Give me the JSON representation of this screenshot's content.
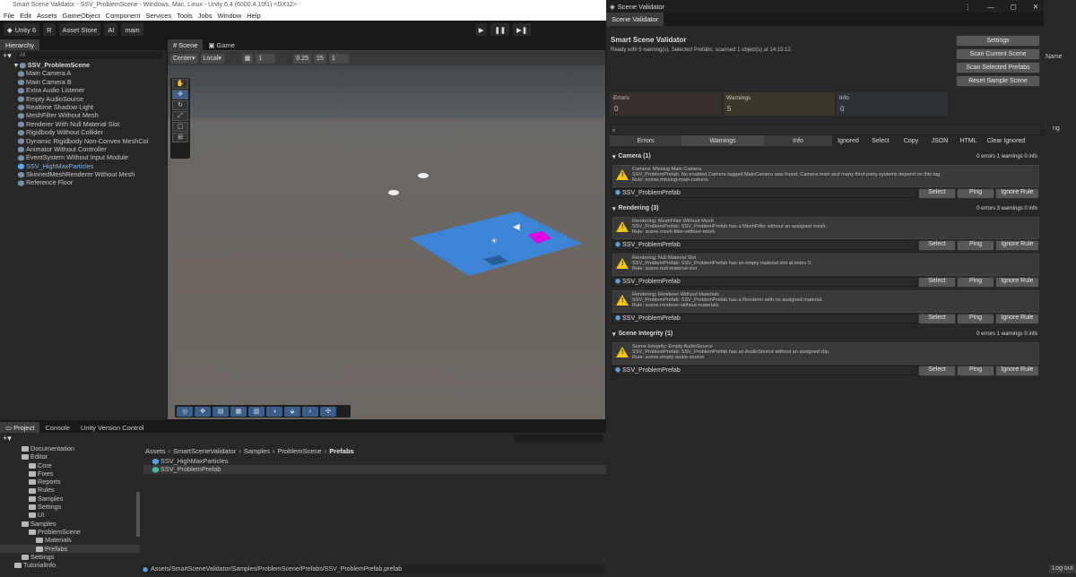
{
  "window_title": "Smart Scene Validator - SSV_ProblemScene - Windows, Mac, Linux - Unity 6.4 (6000.4.10f1) <DX12>",
  "menu": [
    "File",
    "Edit",
    "Assets",
    "GameObject",
    "Component",
    "Services",
    "Tools",
    "Jobs",
    "Window",
    "Help"
  ],
  "toolbar": {
    "account": "Unity 6",
    "user": "R",
    "asset_store": "Asset Store",
    "ai": "AI",
    "branch": "main"
  },
  "hierarchy": {
    "tab": "Hierarchy",
    "search_placeholder": "All",
    "scene": "SSV_ProblemScene",
    "items": [
      "Main Camera A",
      "Main Camera B",
      "Extra Audio Listener",
      "Empty AudioSource",
      "Realtime Shadow Light",
      "MeshFilter Without Mesh",
      "Renderer With Null Material Slot",
      "Rigidbody Without Collider",
      "Dynamic Rigidbody Non-Convex MeshCol",
      "Animator Without Controller",
      "EventSystem Without Input Module",
      "SSV_HighMaxParticles",
      "SkinnedMeshRenderer Without Mesh",
      "Reference Floor"
    ]
  },
  "scene_tabs": [
    "Scene",
    "Game"
  ],
  "scene_toolbar": {
    "pivot": "Center",
    "space": "Local",
    "grid": "1",
    "snap": "0.25",
    "angle": "15",
    "scale": "1"
  },
  "validator": {
    "window_title": "Scene Validator",
    "tab": "Scene Validator",
    "heading": "Smart Scene Validator",
    "status": "Ready with 5 warning(s). Selected Prefabs; scanned 1 object(s) at 14:15:12.",
    "buttons": [
      "Settings",
      "Scan Current Scene",
      "Scan Selected Prefabs",
      "Reset Sample Scene"
    ],
    "counters": [
      {
        "label": "Errors",
        "value": "0",
        "color": "#3a2f2f"
      },
      {
        "label": "Warnings",
        "value": "5",
        "color": "#3b3829"
      },
      {
        "label": "Info",
        "value": "0",
        "color": "#2f3338"
      }
    ],
    "filters": [
      "Errors",
      "Warnings",
      "Info",
      "Ignored",
      "Select",
      "Copy",
      "JSON",
      "HTML",
      "Clear Ignored"
    ],
    "sections": [
      {
        "title": "Camera (1)",
        "summary": "0 errors   1 warnings   0 info",
        "issues": [
          {
            "lines": [
              "Camera: Missing Main Camera",
              "SSV_ProblemPrefab: No enabled Camera tagged MainCamera was found. Camera.main and many third-party systems depend on this tag.",
              "Rule: scene.missing-main-camera"
            ],
            "object": "SSV_ProblemPrefab"
          }
        ]
      },
      {
        "title": "Rendering (3)",
        "summary": "0 errors   3 warnings   0 info",
        "issues": [
          {
            "lines": [
              "Rendering: MeshFilter Without Mesh",
              "SSV_ProblemPrefab: SSV_ProblemPrefab has a MeshFilter without an assigned mesh.",
              "Rule: scene.mesh-filter-without-mesh"
            ],
            "object": "SSV_ProblemPrefab"
          },
          {
            "lines": [
              "Rendering: Null Material Slot",
              "SSV_ProblemPrefab: SSV_ProblemPrefab has an empty material slot at index 0.",
              "Rule: scene.null-material-slot"
            ],
            "object": "SSV_ProblemPrefab"
          },
          {
            "lines": [
              "Rendering: Renderer Without Materials",
              "SSV_ProblemPrefab: SSV_ProblemPrefab has a Renderer with no assigned material.",
              "Rule: scene.renderer-without-materials"
            ],
            "object": "SSV_ProblemPrefab"
          }
        ]
      },
      {
        "title": "Scene Integrity (1)",
        "summary": "0 errors   1 warnings   0 info",
        "issues": [
          {
            "lines": [
              "Scene Integrity: Empty AudioSource",
              "SSV_ProblemPrefab: SSV_ProblemPrefab has an AudioSource without an assigned clip.",
              "Rule: scene.empty-audio-source"
            ],
            "object": "SSV_ProblemPrefab"
          }
        ]
      }
    ],
    "row_buttons": [
      "Select",
      "Ping",
      "Ignore Rule"
    ]
  },
  "project": {
    "tabs": [
      "Project",
      "Console",
      "Unity Version Control"
    ],
    "tree": [
      {
        "label": "Documentation",
        "indent": 2
      },
      {
        "label": "Editor",
        "indent": 2
      },
      {
        "label": "Core",
        "indent": 3
      },
      {
        "label": "Fixes",
        "indent": 3
      },
      {
        "label": "Reports",
        "indent": 3
      },
      {
        "label": "Rules",
        "indent": 3
      },
      {
        "label": "Samples",
        "indent": 3
      },
      {
        "label": "Settings",
        "indent": 3
      },
      {
        "label": "UI",
        "indent": 3
      },
      {
        "label": "Samples",
        "indent": 2
      },
      {
        "label": "ProblemScene",
        "indent": 3
      },
      {
        "label": "Materials",
        "indent": 4
      },
      {
        "label": "Prefabs",
        "indent": 4
      },
      {
        "label": "Settings",
        "indent": 2
      },
      {
        "label": "TutorialInfo",
        "indent": 1
      }
    ],
    "breadcrumb": [
      "Assets",
      "SmartSceneValidator",
      "Samples",
      "ProblemScene",
      "Prefabs"
    ],
    "files": [
      "SSV_HighMaxParticles",
      "SSV_ProblemPrefab"
    ],
    "path": "Assets/SmartSceneValidator/Samples/ProblemScene/Prefabs/SSV_ProblemPrefab.prefab"
  },
  "right_panel": {
    "col": "Name",
    "frag": "ng",
    "logout": "Log out"
  }
}
